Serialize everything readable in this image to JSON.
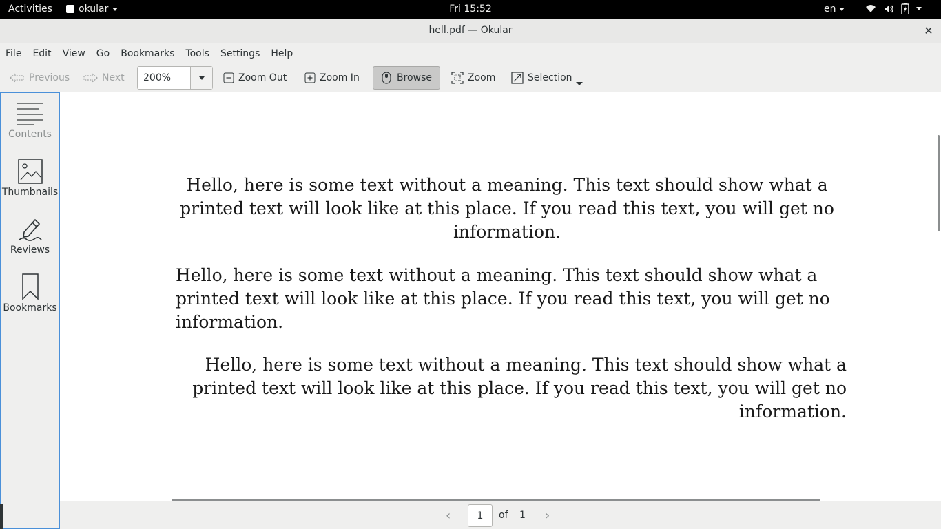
{
  "topbar": {
    "activities": "Activities",
    "app_name": "okular",
    "clock": "Fri 15:52",
    "language": "en"
  },
  "window": {
    "title": "hell.pdf — Okular"
  },
  "menu": [
    "File",
    "Edit",
    "View",
    "Go",
    "Bookmarks",
    "Tools",
    "Settings",
    "Help"
  ],
  "toolbar": {
    "previous": "Previous",
    "next": "Next",
    "zoom_value": "200%",
    "zoom_out": "Zoom Out",
    "zoom_in": "Zoom In",
    "browse": "Browse",
    "zoom_tool": "Zoom",
    "selection": "Selection"
  },
  "sidebar": {
    "items": [
      {
        "label": "Contents",
        "icon": "contents-icon"
      },
      {
        "label": "Thumbnails",
        "icon": "thumbnails-icon"
      },
      {
        "label": "Reviews",
        "icon": "reviews-icon"
      },
      {
        "label": "Bookmarks",
        "icon": "bookmark-icon"
      }
    ]
  },
  "document": {
    "paragraphs": [
      "Hello, here is some text without a meaning. This text should show what a printed text will look like at this place. If you read this text, you will get no information.",
      "Hello, here is some text without a meaning. This text should show what a printed text will look like at this place. If you read this text, you will get no information.",
      "Hello, here is some text without a meaning. This text should show what a printed text will look like at this place. If you read this text, you will get no information."
    ]
  },
  "pagebar": {
    "current_page": "1",
    "of_label": "of",
    "total_pages": "1"
  }
}
